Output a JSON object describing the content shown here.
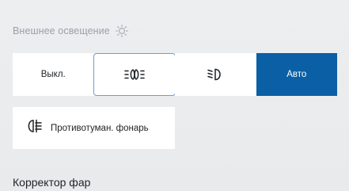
{
  "lighting": {
    "section_title": "Внешнее освещение",
    "section_icon": "sun-icon",
    "modes": [
      {
        "id": "off",
        "label": "Выкл.",
        "icon": null
      },
      {
        "id": "parking",
        "label": "",
        "icon": "parking-lights-icon"
      },
      {
        "id": "low-beam",
        "label": "",
        "icon": "low-beam-icon"
      },
      {
        "id": "auto",
        "label": "Авто",
        "icon": null
      }
    ],
    "selected_mode": "auto",
    "focused_mode": "parking",
    "fog_light": {
      "label": "Противотуман. фонарь",
      "icon": "rear-fog-light-icon",
      "enabled": false
    }
  },
  "headlight_corrector": {
    "title": "Корректор фар"
  },
  "colors": {
    "accent": "#0b5fa5",
    "focus_border": "#6f9dc6",
    "background": "#eaeced",
    "panel": "#ffffff",
    "muted_text": "#9ba1a7"
  }
}
